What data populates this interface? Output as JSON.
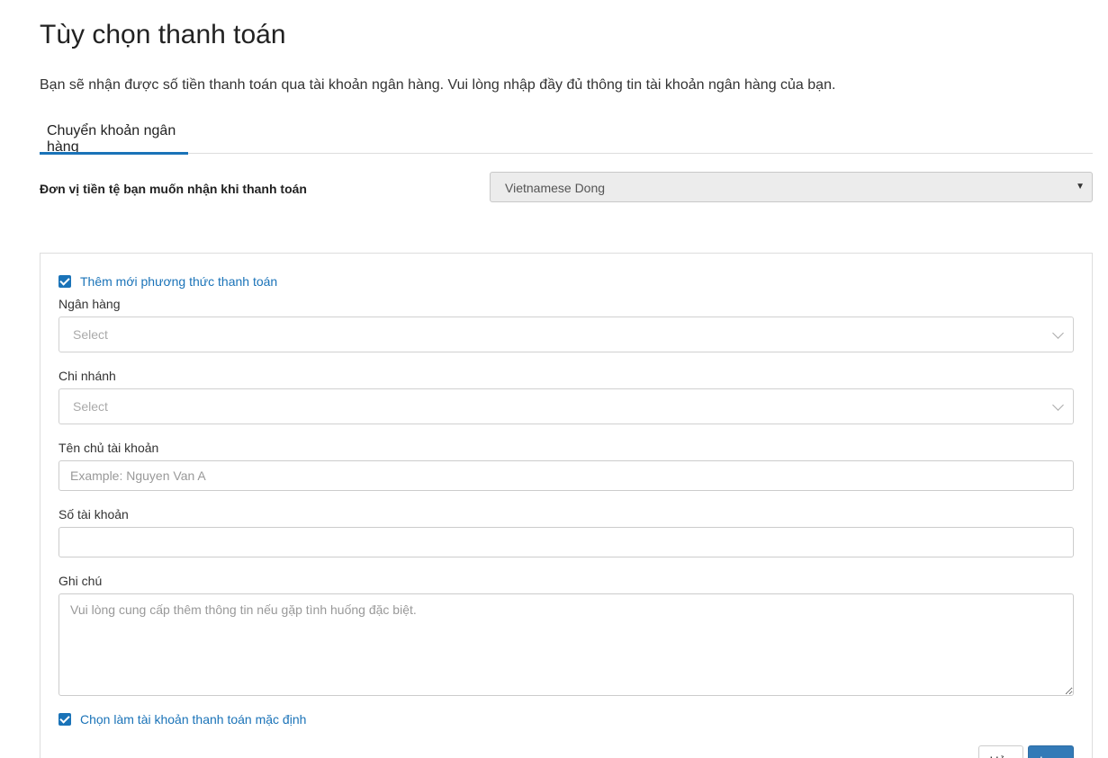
{
  "page": {
    "title": "Tùy chọn thanh toán",
    "intro": "Bạn sẽ nhận được số tiền thanh toán qua tài khoản ngân hàng. Vui lòng nhập đầy đủ thông tin tài khoản ngân hàng của bạn."
  },
  "tabs": [
    {
      "label": "Chuyển khoản ngân hàng",
      "active": true
    }
  ],
  "currency": {
    "label": "Đơn vị tiền tệ bạn muốn nhận khi thanh toán",
    "value": "Vietnamese Dong"
  },
  "form": {
    "add_method_label": "Thêm mới phương thức thanh toán",
    "bank": {
      "label": "Ngân hàng",
      "placeholder": "Select"
    },
    "branch": {
      "label": "Chi nhánh",
      "placeholder": "Select"
    },
    "holder": {
      "label": "Tên chủ tài khoản",
      "placeholder": "Example: Nguyen Van A",
      "value": ""
    },
    "account_number": {
      "label": "Số tài khoản",
      "placeholder": "",
      "value": ""
    },
    "note": {
      "label": "Ghi chú",
      "placeholder": "Vui lòng cung cấp thêm thông tin nếu gặp tình huống đặc biệt."
    },
    "default_label": "Chọn làm tài khoản thanh toán mặc định",
    "cancel_label": "Hủy",
    "save_label": "Lưu"
  },
  "colors": {
    "accent": "#1a73b8",
    "primary_button": "#337ab7"
  }
}
